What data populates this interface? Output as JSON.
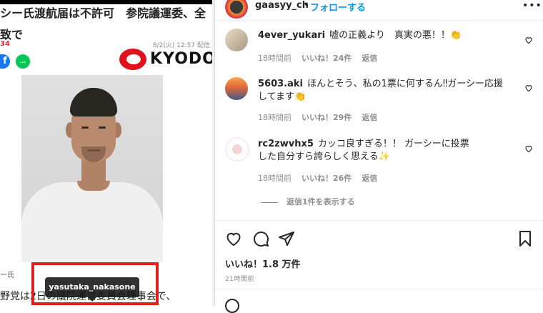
{
  "article": {
    "headline_line1": "シー氏渡航届は不許可　参院議運委、全",
    "headline_line2": "致で",
    "meta_left": "34",
    "date": "8/2(火) 12:57 配信",
    "fb_label": "f",
    "line_label": "LINE",
    "brand": "KYODO",
    "caption": "ー氏",
    "body_text": "野党は2日の議院運営委員会理事会で、",
    "tag_label": "yasutaka_nakasone"
  },
  "post": {
    "username": "gaasyy_ch",
    "dot": "•",
    "follow_label": "フォローする",
    "more_label": "•••",
    "comments": [
      {
        "user": "4ever_yukari",
        "text": "嘘の正義より　真実の悪！！👏",
        "time": "18時間前",
        "likes": "いいね！24件",
        "reply": "返信"
      },
      {
        "user": "5603.aki",
        "text": "ほんとそう、私の1票に何するん‼ガーシー応援してます👏",
        "time": "18時間前",
        "likes": "いいね！29件",
        "reply": "返信"
      },
      {
        "user": "rc2zwvhx5",
        "text": "カッコ良すぎる！！ ガーシーに投票した自分すら誇らしく思える✨",
        "time": "18時間前",
        "likes": "いいね！26件",
        "reply": "返信"
      }
    ],
    "view_replies": "返信1件を表示する",
    "likes_total": "いいね！1.8 万件",
    "time_ago": "21時間前"
  },
  "icons": {
    "heart": "heart-icon",
    "comment": "comment-icon",
    "share": "share-icon",
    "save": "bookmark-icon"
  },
  "colors": {
    "follow": "#0095f6",
    "highlight_box": "#e31e1e",
    "kyodo_red": "#e0121b"
  }
}
